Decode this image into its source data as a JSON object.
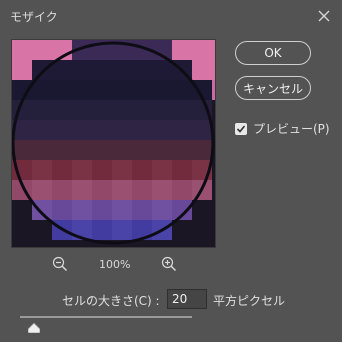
{
  "window": {
    "title": "モザイク"
  },
  "buttons": {
    "ok": "OK",
    "cancel": "キャンセル"
  },
  "preview_checkbox": {
    "label": "プレビュー(P)",
    "checked": true
  },
  "zoom": {
    "level": "100%"
  },
  "cell_size": {
    "label": "セルの大きさ(C) :",
    "value": "20",
    "unit": "平方ピクセル",
    "slider_fraction": 0.08
  },
  "icons": {
    "close": "close-icon",
    "zoom_out": "zoom-out-icon",
    "zoom_in": "zoom-in-icon",
    "check": "checkmark-icon"
  },
  "colors": {
    "background": "#535353",
    "accent_pink": "#d874a6",
    "accent_blue": "#3a3aa8"
  }
}
